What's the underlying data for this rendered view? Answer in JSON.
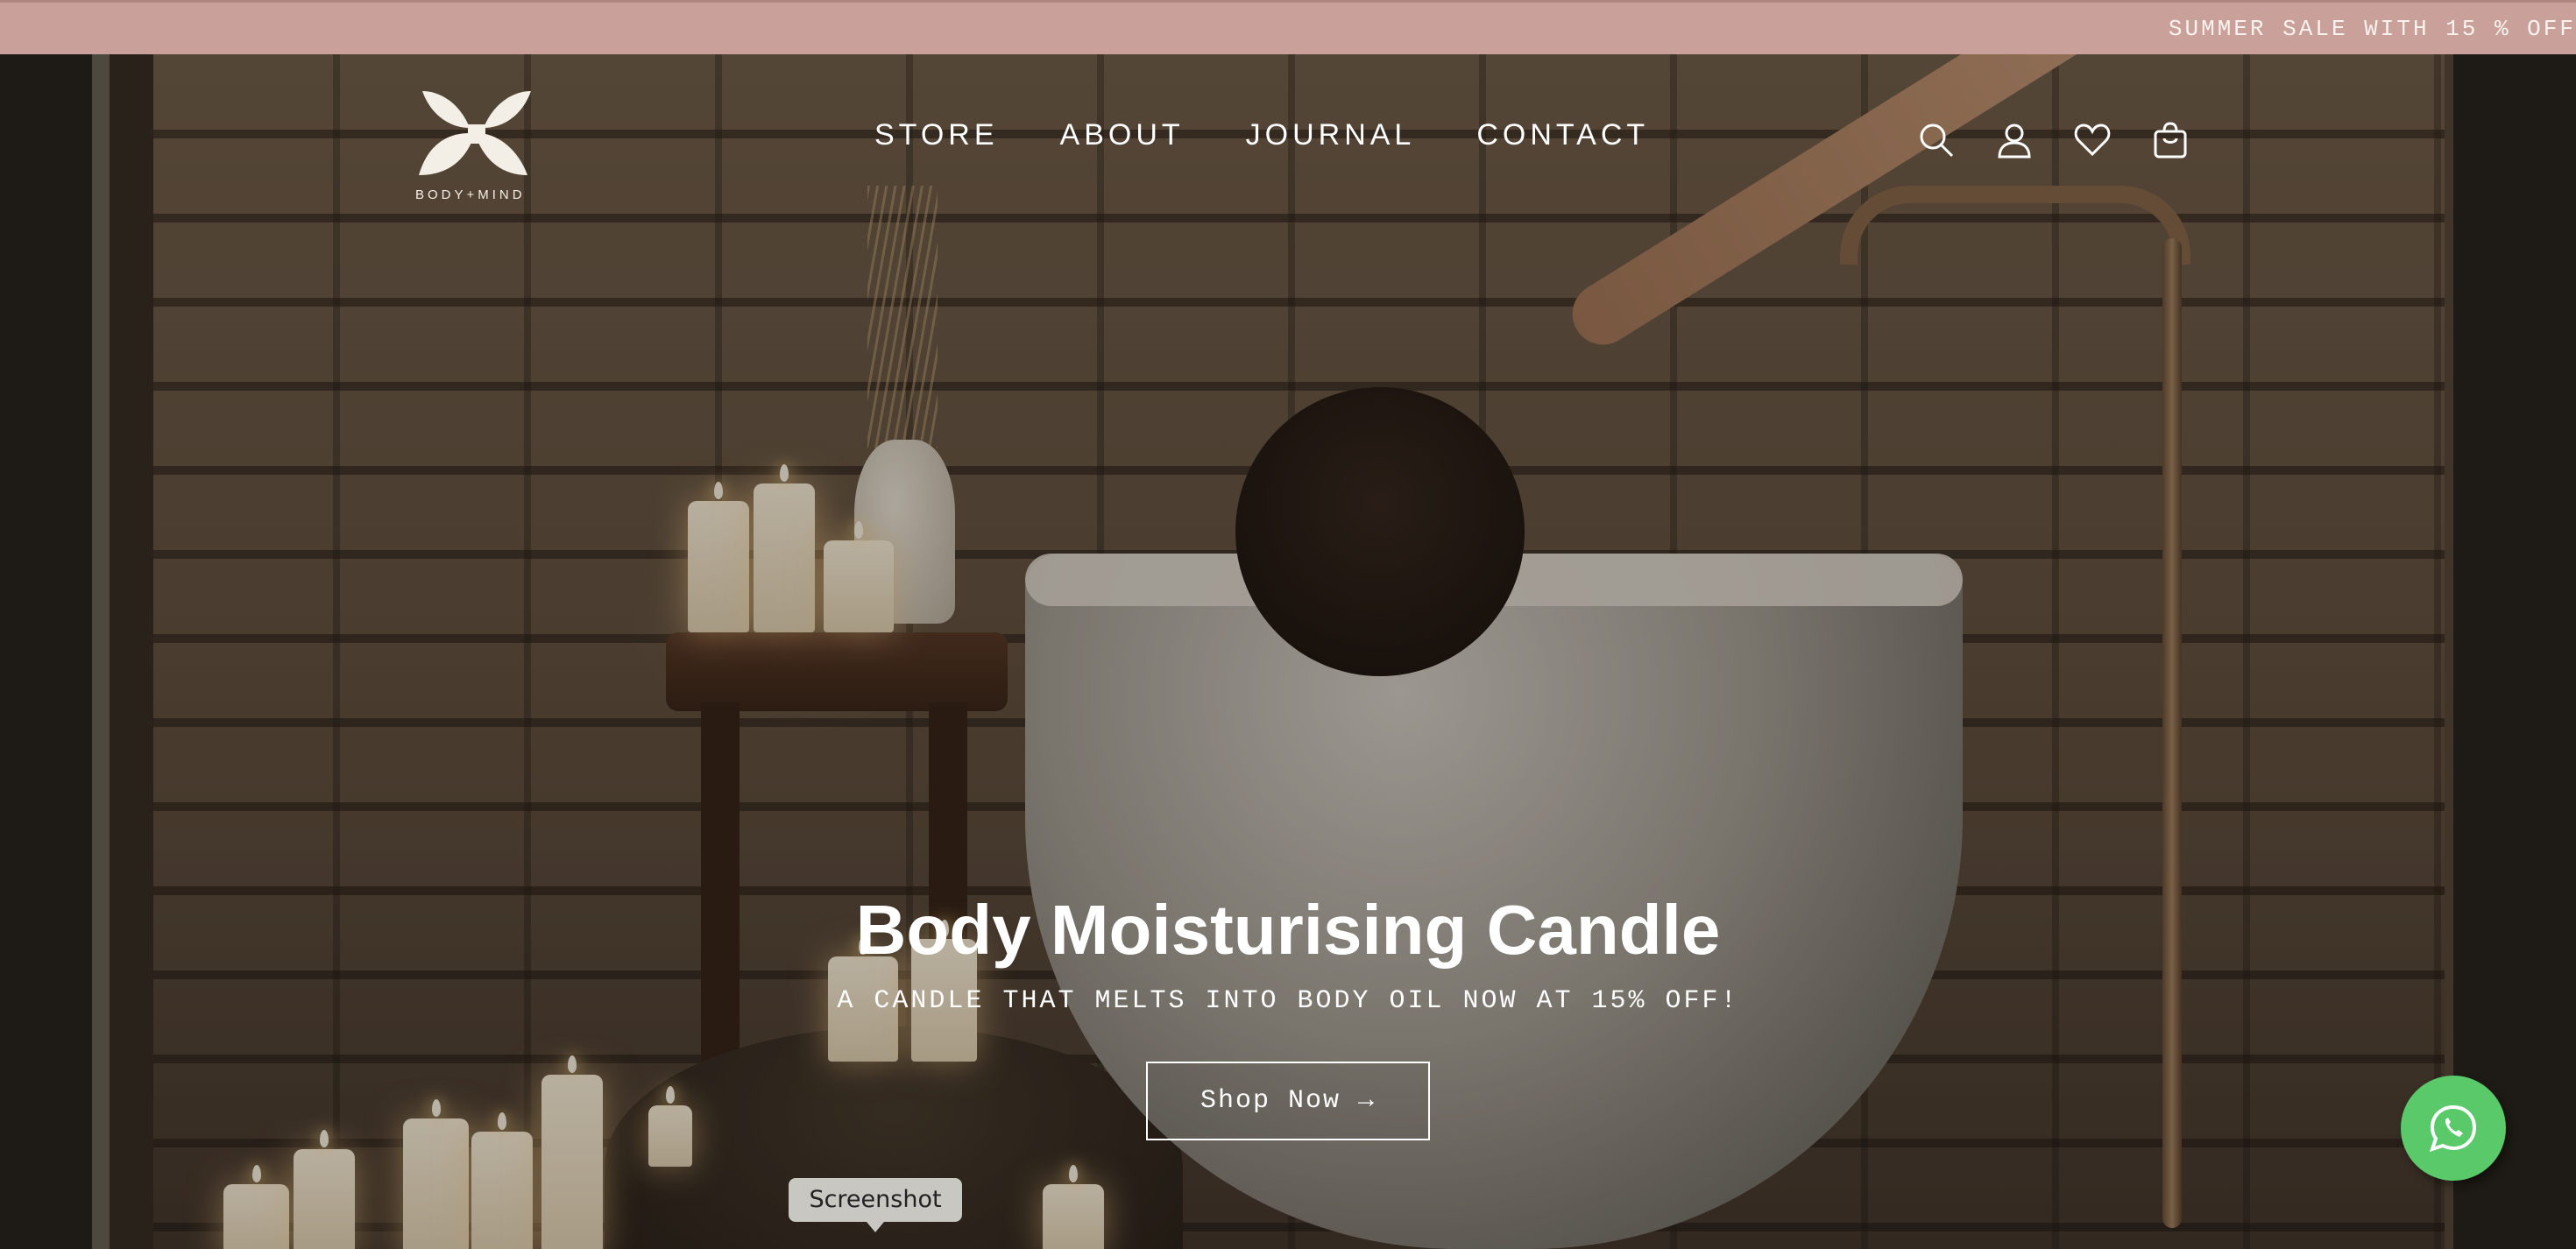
{
  "announcement": {
    "text": "SUMMER SALE WITH 15 % OFF"
  },
  "header": {
    "logo_text": "BODY+MIND",
    "nav": [
      {
        "label": "STORE"
      },
      {
        "label": "ABOUT"
      },
      {
        "label": "JOURNAL"
      },
      {
        "label": "CONTACT"
      }
    ],
    "icons": [
      "search-icon",
      "account-icon",
      "wishlist-heart-icon",
      "cart-icon"
    ]
  },
  "hero": {
    "title": "Body Moisturising Candle",
    "subtitle": "A CANDLE THAT MELTS INTO BODY OIL NOW AT 15% OFF!",
    "cta_label": "Shop Now →"
  },
  "widgets": {
    "whatsapp_icon": "whatsapp-icon",
    "tooltip": "Screenshot"
  },
  "colors": {
    "announcement_bg": "#c9a19a",
    "whatsapp_green": "#5ac96a",
    "logo_cream": "#f4efe6"
  }
}
